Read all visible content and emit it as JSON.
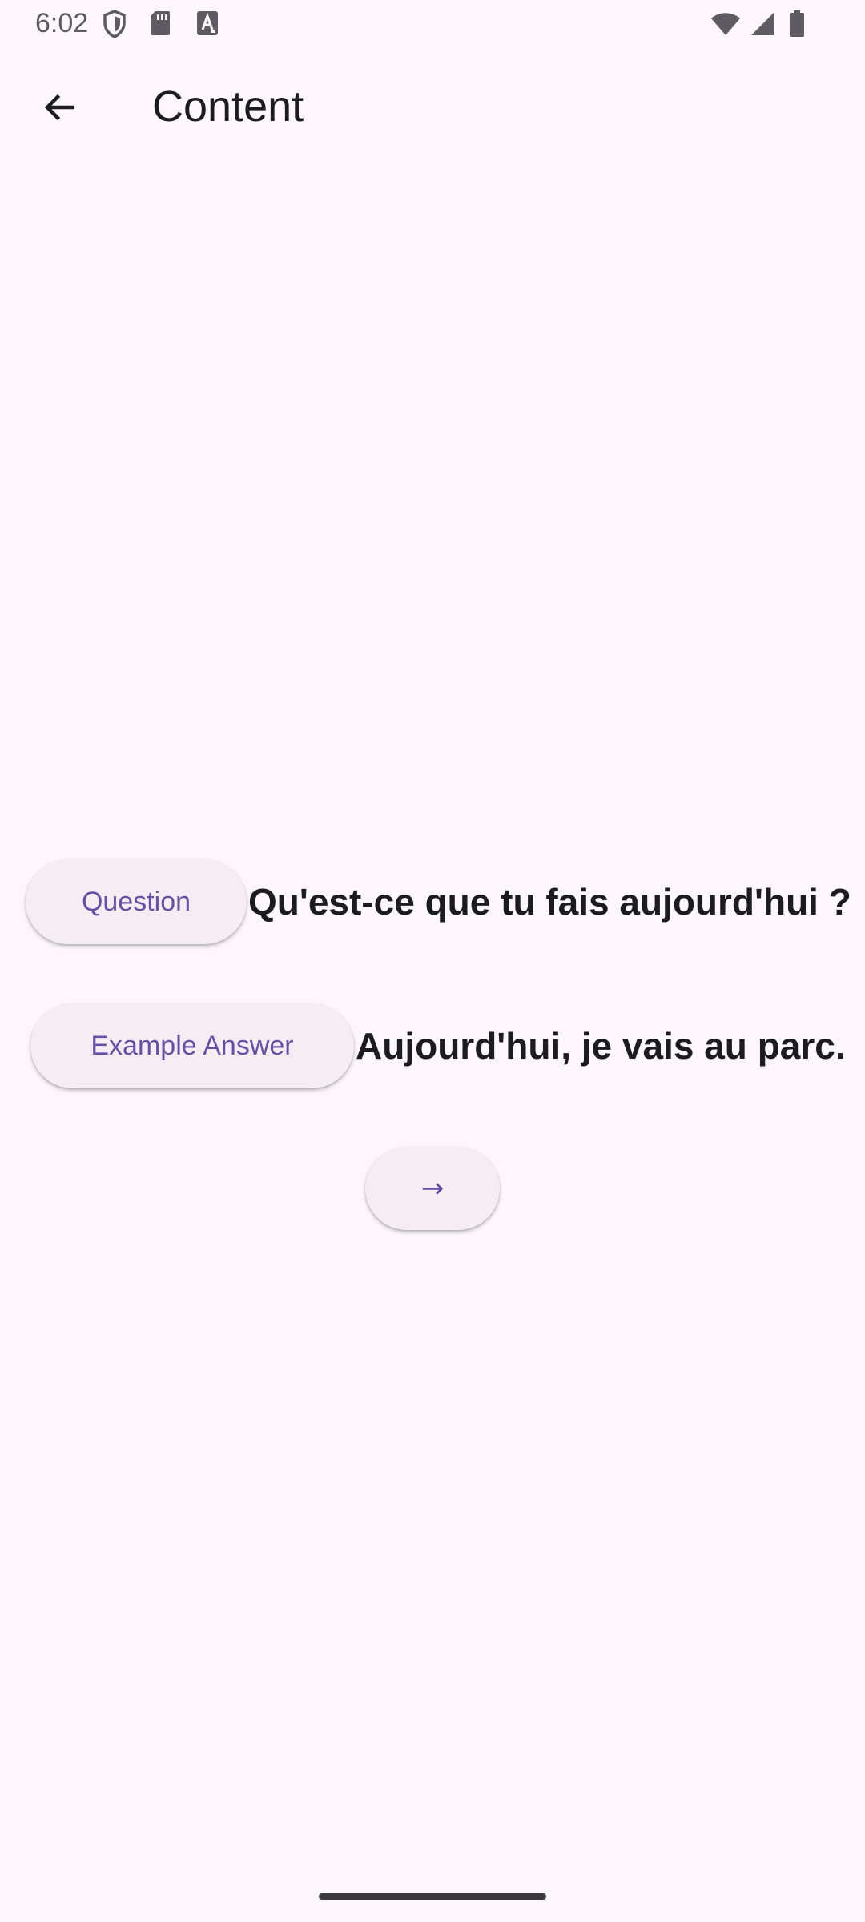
{
  "status_bar": {
    "time": "6:02",
    "icons": [
      "shield-icon",
      "sd-card-icon",
      "font-a-icon",
      "wifi-icon",
      "signal-icon",
      "battery-icon"
    ]
  },
  "app_bar": {
    "back_icon": "arrow-back-icon",
    "title": "Content"
  },
  "question": {
    "button_label": "Question",
    "text": "Qu'est-ce que tu fais aujourd'hui ?"
  },
  "answer": {
    "button_label": "Example Answer",
    "text": "Aujourd'hui, je vais au parc."
  },
  "next_button": {
    "label": "→"
  },
  "colors": {
    "background": "#FDF7FD",
    "accent": "#6750A4",
    "button_surface": "#F4EEF4",
    "text": "#1C1B1F"
  }
}
